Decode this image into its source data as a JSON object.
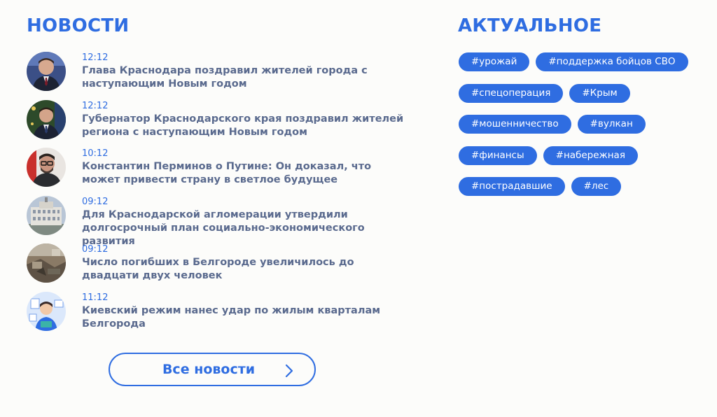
{
  "news": {
    "title": "НОВОСТИ",
    "items": [
      {
        "time": "12:12",
        "headline": "Глава Краснодара поздравил жителей города с наступающим Новым годом",
        "thumb": "portrait-man-suit"
      },
      {
        "time": "12:12",
        "headline": "Губернатор Краснодарского края поздравил жителей региона с наступающим Новым годом",
        "thumb": "portrait-man-tree"
      },
      {
        "time": "10:12",
        "headline": "Константин Перминов о Путине: Он доказал, что может привести страну в светлое будущее",
        "thumb": "portrait-man-glasses"
      },
      {
        "time": "09:12",
        "headline": "Для Краснодарской агломерации утвердили долгосрочный план социально-экономического развития",
        "thumb": "building"
      },
      {
        "time": "09:12",
        "headline": "Число погибших в Белгороде увеличилось до двадцати двух человек",
        "thumb": "damaged-interior"
      },
      {
        "time": "11:12",
        "headline": "Киевский режим нанес удар по жилым кварталам Белгорода",
        "thumb": "illustration"
      }
    ],
    "all_button_label": "Все новости"
  },
  "actual": {
    "title": "АКТУАЛЬНОЕ",
    "tag_rows": [
      [
        "#урожай",
        "#поддержка бойцов СВО"
      ],
      [
        "#спецоперация",
        "#Крым"
      ],
      [
        "#мошенничество",
        "#вулкан"
      ],
      [
        "#финансы",
        "#набережная"
      ],
      [
        "#пострадавшие",
        "#лес"
      ]
    ]
  },
  "colors": {
    "accent": "#2f6de1",
    "headline": "#5a6a8e",
    "background": "#fcfcfa"
  }
}
